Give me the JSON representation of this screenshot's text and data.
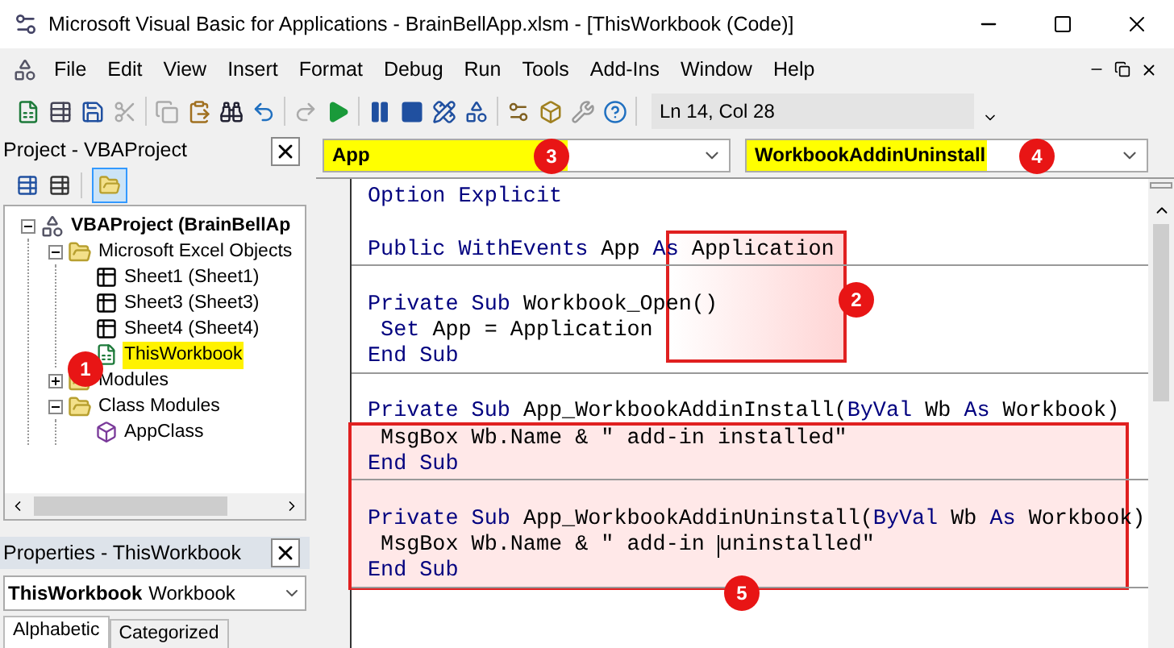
{
  "window": {
    "title": "Microsoft Visual Basic for Applications - BrainBellApp.xlsm - [ThisWorkbook (Code)]"
  },
  "menu": [
    "File",
    "Edit",
    "View",
    "Insert",
    "Format",
    "Debug",
    "Run",
    "Tools",
    "Add-Ins",
    "Window",
    "Help"
  ],
  "toolbar": {
    "status": "Ln 14, Col 28"
  },
  "project": {
    "title": "Project - VBAProject",
    "tree": [
      {
        "label": "VBAProject (BrainBellAp",
        "kind": "project",
        "expanded": true,
        "selected": false,
        "children": [
          {
            "label": "Microsoft Excel Objects",
            "kind": "folder",
            "expanded": true,
            "selected": false,
            "children": [
              {
                "label": "Sheet1 (Sheet1)",
                "kind": "sheet",
                "selected": false
              },
              {
                "label": "Sheet3 (Sheet3)",
                "kind": "sheet",
                "selected": false
              },
              {
                "label": "Sheet4 (Sheet4)",
                "kind": "sheet",
                "selected": false
              },
              {
                "label": "ThisWorkbook",
                "kind": "workbook",
                "selected": true
              }
            ]
          },
          {
            "label": "Modules",
            "kind": "folder",
            "expanded": false,
            "selected": false
          },
          {
            "label": "Class Modules",
            "kind": "folder",
            "expanded": true,
            "selected": false,
            "children": [
              {
                "label": "AppClass",
                "kind": "class",
                "selected": false
              }
            ]
          }
        ]
      }
    ]
  },
  "properties": {
    "title": "Properties - ThisWorkbook",
    "object": "ThisWorkbook",
    "type": "Workbook",
    "tabs": [
      {
        "label": "Alphabetic",
        "selected": true
      },
      {
        "label": "Categorized",
        "selected": false
      }
    ]
  },
  "code": {
    "object_combo": {
      "value": "App",
      "highlighted": true
    },
    "procedure_combo": {
      "value": "WorkbookAddinUninstall",
      "highlighted": true
    },
    "procedures": [
      {
        "lines": [
          {
            "kind": "code",
            "segments": [
              {
                "text": "Option Explicit",
                "kind": "keyword"
              }
            ]
          },
          {
            "kind": "blank"
          },
          {
            "kind": "code",
            "segments": [
              {
                "text": "Public WithEvents",
                "kind": "keyword"
              },
              {
                "text": " App ",
                "kind": "plain"
              },
              {
                "text": "As",
                "kind": "keyword"
              },
              {
                "text": " Application",
                "kind": "plain"
              }
            ]
          }
        ]
      },
      {
        "lines": [
          {
            "kind": "blank"
          },
          {
            "kind": "code",
            "segments": [
              {
                "text": "Private Sub",
                "kind": "keyword"
              },
              {
                "text": " Workbook_Open()",
                "kind": "plain"
              }
            ]
          },
          {
            "kind": "code",
            "segments": [
              {
                "text": " Set",
                "kind": "keyword"
              },
              {
                "text": " App = Application",
                "kind": "plain"
              }
            ]
          },
          {
            "kind": "code",
            "segments": [
              {
                "text": "End Sub",
                "kind": "keyword"
              }
            ]
          }
        ]
      },
      {
        "lines": [
          {
            "kind": "blank"
          },
          {
            "kind": "code",
            "segments": [
              {
                "text": "Private Sub",
                "kind": "keyword"
              },
              {
                "text": " App_WorkbookAddinInstall(",
                "kind": "plain"
              },
              {
                "text": "ByVal",
                "kind": "keyword"
              },
              {
                "text": " Wb ",
                "kind": "plain"
              },
              {
                "text": "As",
                "kind": "keyword"
              },
              {
                "text": " Workbook)",
                "kind": "plain"
              }
            ]
          },
          {
            "kind": "code",
            "segments": [
              {
                "text": " MsgBox Wb.Name & \" add-in installed\"",
                "kind": "plain"
              }
            ]
          },
          {
            "kind": "code",
            "segments": [
              {
                "text": "End Sub",
                "kind": "keyword"
              }
            ]
          }
        ]
      },
      {
        "lines": [
          {
            "kind": "blank"
          },
          {
            "kind": "code",
            "segments": [
              {
                "text": "Private Sub",
                "kind": "keyword"
              },
              {
                "text": " App_WorkbookAddinUninstall(",
                "kind": "plain"
              },
              {
                "text": "ByVal",
                "kind": "keyword"
              },
              {
                "text": " Wb ",
                "kind": "plain"
              },
              {
                "text": "As",
                "kind": "keyword"
              },
              {
                "text": " Workbook)",
                "kind": "plain"
              }
            ]
          },
          {
            "kind": "code",
            "segments": [
              {
                "text": " MsgBox Wb.Name & \" add-in ",
                "kind": "plain"
              },
              {
                "text": "uninstalled\"",
                "kind": "plain",
                "caret": true
              }
            ]
          },
          {
            "kind": "code",
            "segments": [
              {
                "text": "End Sub",
                "kind": "keyword"
              }
            ]
          }
        ]
      }
    ]
  },
  "annotations": [
    {
      "label": "1",
      "kind": "dot"
    },
    {
      "label": "2",
      "kind": "boxed"
    },
    {
      "label": "3",
      "kind": "dot"
    },
    {
      "label": "4",
      "kind": "dot"
    },
    {
      "label": "5",
      "kind": "boxed"
    }
  ]
}
